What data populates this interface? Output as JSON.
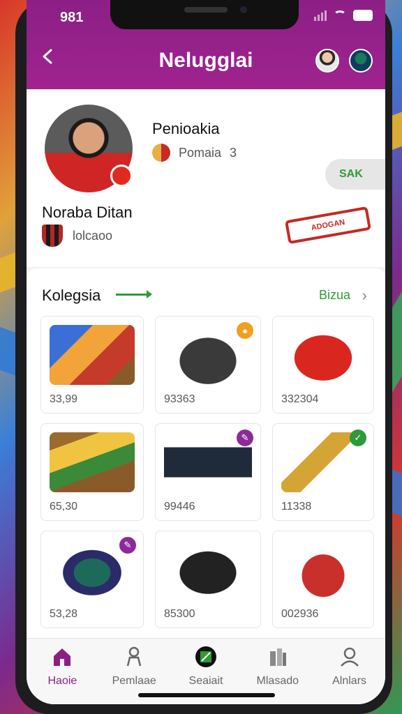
{
  "status_bar": {
    "time": "981"
  },
  "header": {
    "title": "Nelugglai"
  },
  "profile": {
    "display_name": "Penioakia",
    "sport_label": "Pomaia",
    "sport_count": "3",
    "username": "Noraba Ditan",
    "club": "lolcaoo",
    "action_button": "SAK",
    "scarf_text": "ADOGAN"
  },
  "collection": {
    "title": "Kolegsia",
    "see_all": "Bizua",
    "items": [
      {
        "name": "item-box-colorful",
        "value": "33,99",
        "badge": ""
      },
      {
        "name": "item-car",
        "value": "93363",
        "badge": "orange"
      },
      {
        "name": "item-case-red",
        "value": "332304",
        "badge": ""
      },
      {
        "name": "item-tray",
        "value": "65,30",
        "badge": ""
      },
      {
        "name": "item-bag-dark",
        "value": "99446",
        "badge": "purple"
      },
      {
        "name": "item-scepter",
        "value": "11338",
        "badge": "green"
      },
      {
        "name": "item-plaque",
        "value": "53,28",
        "badge": "purple"
      },
      {
        "name": "item-handbag",
        "value": "85300",
        "badge": ""
      },
      {
        "name": "item-medal",
        "value": "002936",
        "badge": ""
      }
    ]
  },
  "tabs": [
    {
      "label": "Haoie",
      "icon": "home-icon",
      "active": true
    },
    {
      "label": "Pemlaae",
      "icon": "figure-icon",
      "active": false
    },
    {
      "label": "Seaiait",
      "icon": "pitch-icon",
      "active": false
    },
    {
      "label": "Mlasado",
      "icon": "books-icon",
      "active": false
    },
    {
      "label": "Alnlars",
      "icon": "user-icon",
      "active": false
    }
  ],
  "colors": {
    "header": "#8c1f86",
    "accent_green": "#2e9a38",
    "badge_orange": "#f0a020",
    "badge_purple": "#8c2a9a",
    "badge_green": "#2e9a38"
  }
}
